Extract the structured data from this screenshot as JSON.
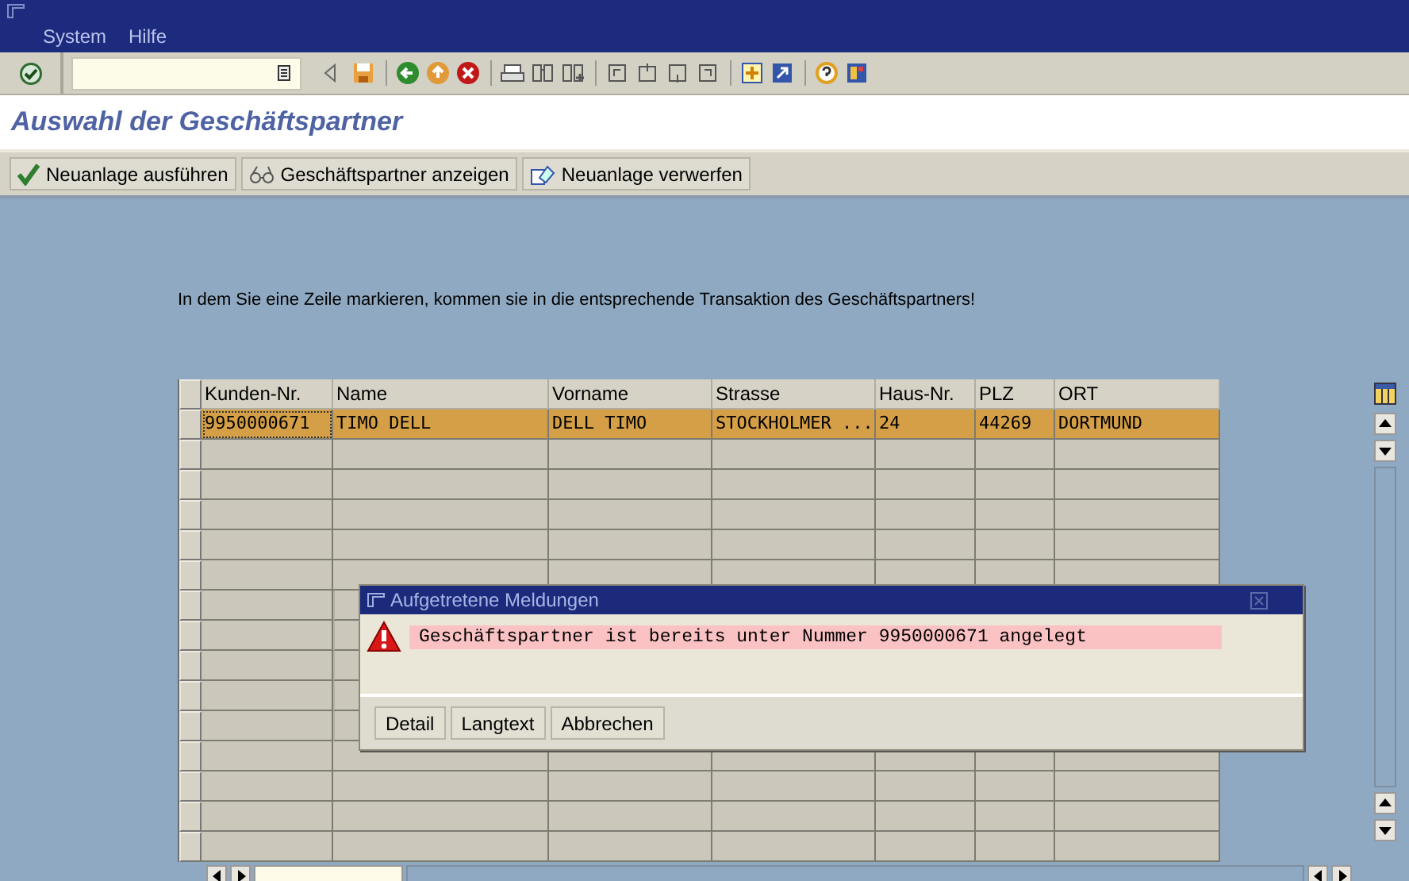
{
  "menu": [
    {
      "label": "System"
    },
    {
      "label": "Hilfe"
    }
  ],
  "screen_title": "Auswahl der Geschäftspartner",
  "app_toolbar": [
    {
      "label": "Neuanlage ausführen"
    },
    {
      "label": "Geschäftspartner anzeigen"
    },
    {
      "label": "Neuanlage verwerfen"
    }
  ],
  "instruction": "In dem Sie eine Zeile markieren, kommen sie in die entsprechende Transaktion des Geschäftspartners!",
  "table": {
    "columns": [
      "Kunden-Nr.",
      "Name",
      "Vorname",
      "Strasse",
      "Haus-Nr.",
      "PLZ",
      "ORT"
    ],
    "rows": [
      {
        "selected": true,
        "cells": [
          "9950000671",
          "TIMO DELL",
          "DELL TIMO",
          "STOCKHOLMER ...",
          "24",
          "44269",
          "DORTMUND"
        ]
      }
    ]
  },
  "dialog": {
    "title": "Aufgetretene Meldungen",
    "messages": [
      {
        "kind": "error",
        "text": "Geschäftspartner ist bereits unter Nummer 9950000671 angelegt"
      }
    ],
    "buttons": [
      "Detail",
      "Langtext",
      "Abbrechen"
    ]
  }
}
